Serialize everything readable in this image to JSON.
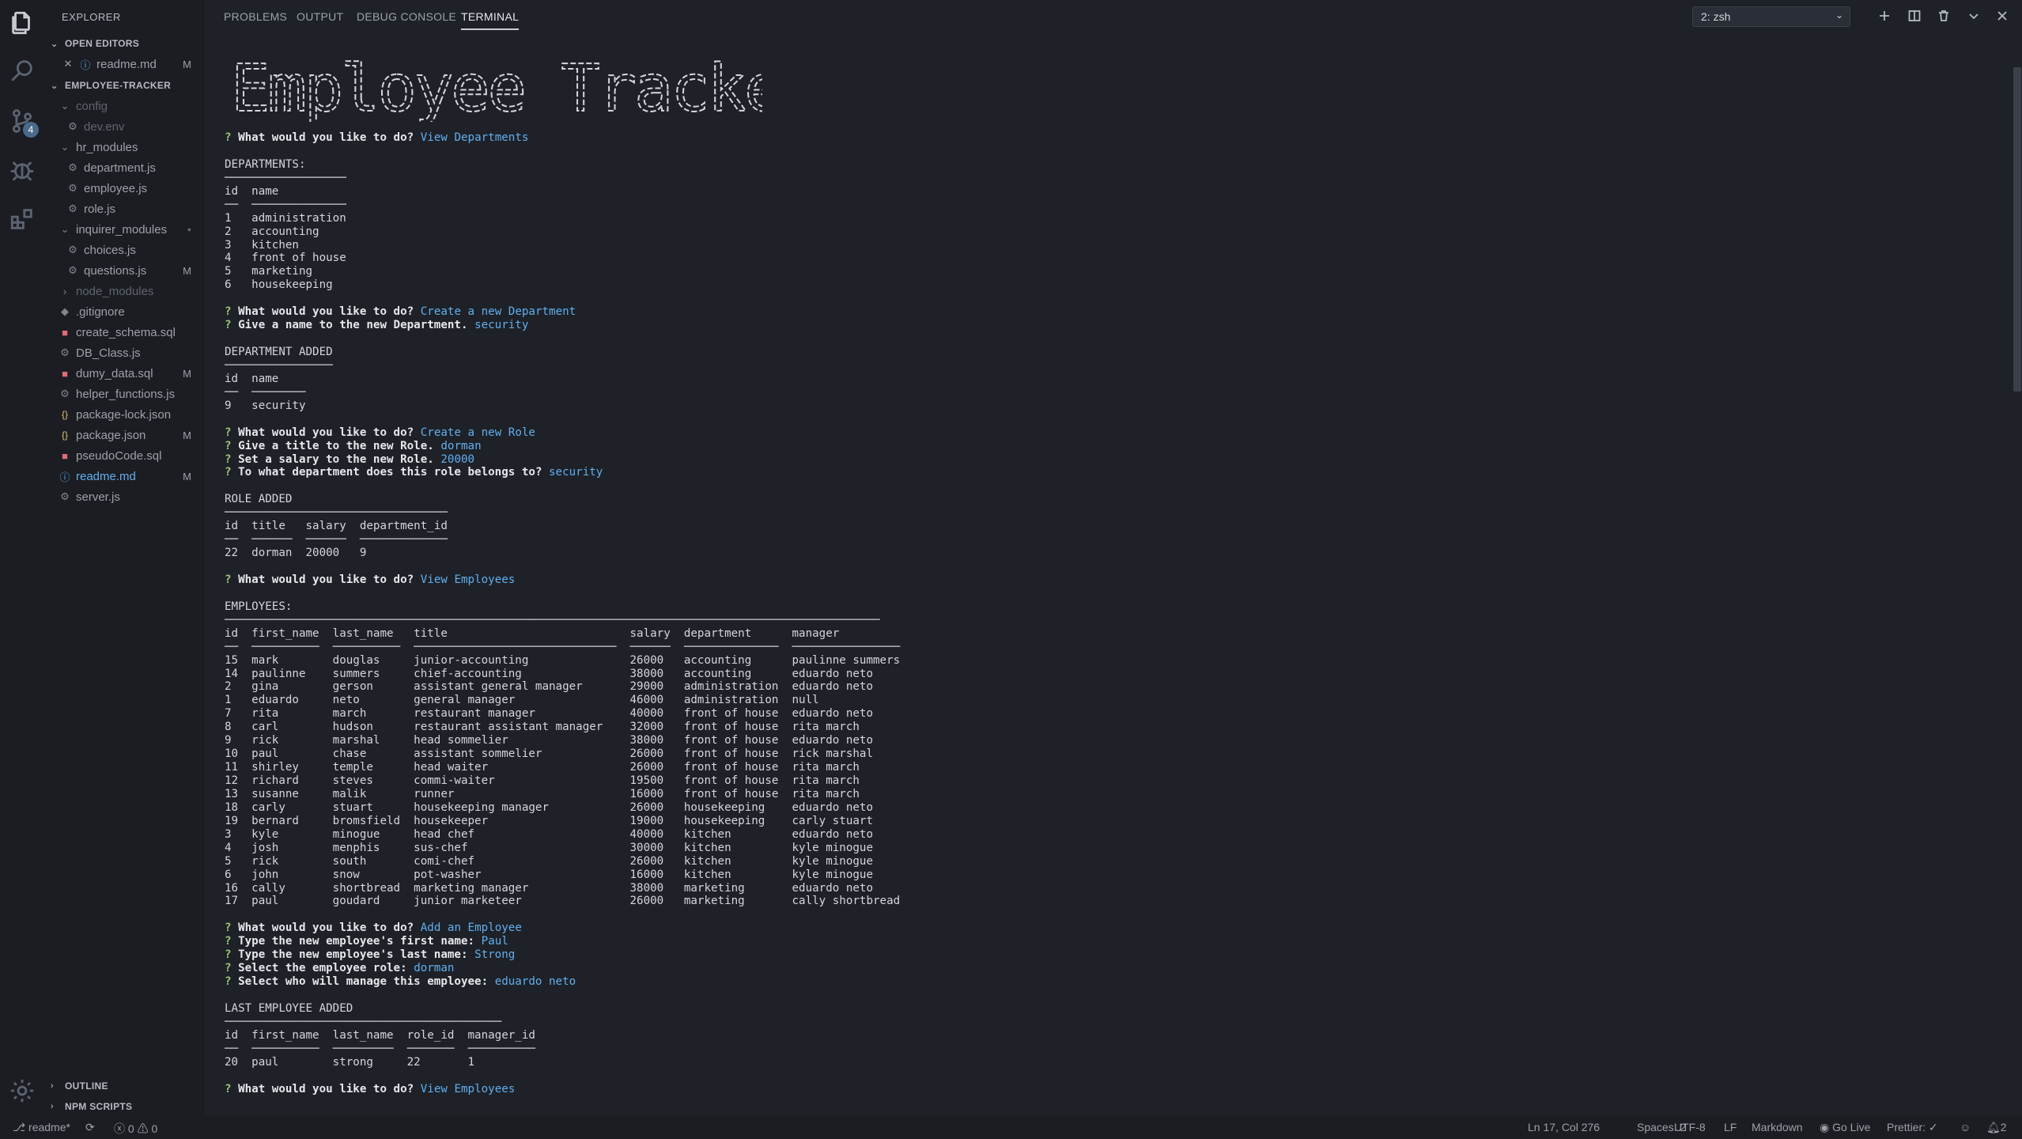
{
  "explorer": {
    "title": "EXPLORER",
    "open_editors_label": "OPEN EDITORS",
    "open_editors": [
      {
        "name": "readme.md",
        "mark": "M"
      }
    ],
    "project_label": "EMPLOYEE-TRACKER",
    "tree": [
      {
        "name": "config",
        "type": "folder",
        "mark": ""
      },
      {
        "name": "dev.env",
        "type": "file",
        "mark": ""
      },
      {
        "name": "hr_modules",
        "type": "folder",
        "mark": ""
      },
      {
        "name": "department.js",
        "type": "file",
        "mark": ""
      },
      {
        "name": "employee.js",
        "type": "file",
        "mark": ""
      },
      {
        "name": "role.js",
        "type": "file",
        "mark": ""
      },
      {
        "name": "inquirer_modules",
        "type": "folder",
        "mark": "●"
      },
      {
        "name": "choices.js",
        "type": "file",
        "mark": ""
      },
      {
        "name": "questions.js",
        "type": "file",
        "mark": "M"
      },
      {
        "name": "node_modules",
        "type": "folder",
        "mark": ""
      },
      {
        "name": ".gitignore",
        "type": "file",
        "mark": ""
      },
      {
        "name": "create_schema.sql",
        "type": "file",
        "mark": ""
      },
      {
        "name": "DB_Class.js",
        "type": "file",
        "mark": ""
      },
      {
        "name": "dumy_data.sql",
        "type": "file",
        "mark": "M"
      },
      {
        "name": "helper_functions.js",
        "type": "file",
        "mark": ""
      },
      {
        "name": "package-lock.json",
        "type": "file",
        "mark": ""
      },
      {
        "name": "package.json",
        "type": "file",
        "mark": "M"
      },
      {
        "name": "pseudoCode.sql",
        "type": "file",
        "mark": ""
      },
      {
        "name": "readme.md",
        "type": "file",
        "mark": "M"
      },
      {
        "name": "server.js",
        "type": "file",
        "mark": ""
      }
    ],
    "outline_label": "OUTLINE",
    "npm_scripts_label": "NPM SCRIPTS"
  },
  "activity": {
    "source_control_badge": "4"
  },
  "panel": {
    "tabs": [
      "PROBLEMS",
      "OUTPUT",
      "DEBUG CONSOLE",
      "TERMINAL"
    ],
    "active_tab": "TERMINAL",
    "terminal_select": "2: zsh"
  },
  "terminal": {
    "banner_text": "Employee Tracker",
    "lines": [
      {
        "kind": "q",
        "q": "What would you like to do?",
        "a": "View Departments"
      },
      {
        "kind": "blank"
      },
      {
        "kind": "text",
        "text": "DEPARTMENTS:"
      },
      {
        "kind": "text",
        "text": "──────────────────"
      },
      {
        "kind": "text",
        "text": "id  name"
      },
      {
        "kind": "text",
        "text": "──  ──────────────"
      },
      {
        "kind": "text",
        "text": "1   administration"
      },
      {
        "kind": "text",
        "text": "2   accounting"
      },
      {
        "kind": "text",
        "text": "3   kitchen"
      },
      {
        "kind": "text",
        "text": "4   front of house"
      },
      {
        "kind": "text",
        "text": "5   marketing"
      },
      {
        "kind": "text",
        "text": "6   housekeeping"
      },
      {
        "kind": "blank"
      },
      {
        "kind": "q",
        "q": "What would you like to do?",
        "a": "Create a new Department"
      },
      {
        "kind": "q",
        "q": "Give a name to the new Department.",
        "a": "security"
      },
      {
        "kind": "blank"
      },
      {
        "kind": "text",
        "text": "DEPARTMENT ADDED"
      },
      {
        "kind": "text",
        "text": "────────────────"
      },
      {
        "kind": "text",
        "text": "id  name"
      },
      {
        "kind": "text",
        "text": "──  ────────"
      },
      {
        "kind": "text",
        "text": "9   security"
      },
      {
        "kind": "blank"
      },
      {
        "kind": "q",
        "q": "What would you like to do?",
        "a": "Create a new Role"
      },
      {
        "kind": "q",
        "q": "Give a title to the new Role.",
        "a": "dorman"
      },
      {
        "kind": "q",
        "q": "Set a salary to the new Role.",
        "a": "20000"
      },
      {
        "kind": "q",
        "q": "To what department does this role belongs to?",
        "a": "security"
      },
      {
        "kind": "blank"
      },
      {
        "kind": "text",
        "text": "ROLE ADDED"
      },
      {
        "kind": "text",
        "text": "─────────────────────────────────"
      },
      {
        "kind": "text",
        "text": "id  title   salary  department_id"
      },
      {
        "kind": "text",
        "text": "──  ──────  ──────  ─────────────"
      },
      {
        "kind": "text",
        "text": "22  dorman  20000   9"
      },
      {
        "kind": "blank"
      },
      {
        "kind": "q",
        "q": "What would you like to do?",
        "a": "View Employees"
      },
      {
        "kind": "blank"
      },
      {
        "kind": "text",
        "text": "EMPLOYEES:"
      },
      {
        "kind": "text",
        "text": "─────────────────────────────────────────────────────────────────────────────────────────────────"
      },
      {
        "kind": "text",
        "text": "id  first_name  last_name   title                           salary  department      manager"
      },
      {
        "kind": "text",
        "text": "──  ──────────  ──────────  ──────────────────────────────  ──────  ──────────────  ────────────────"
      },
      {
        "kind": "text",
        "text": "15  mark        douglas     junior-accounting               26000   accounting      paulinne summers"
      },
      {
        "kind": "text",
        "text": "14  paulinne    summers     chief-accounting                38000   accounting      eduardo neto"
      },
      {
        "kind": "text",
        "text": "2   gina        gerson      assistant general manager       29000   administration  eduardo neto"
      },
      {
        "kind": "text",
        "text": "1   eduardo     neto        general manager                 46000   administration  null"
      },
      {
        "kind": "text",
        "text": "7   rita        march       restaurant manager              40000   front of house  eduardo neto"
      },
      {
        "kind": "text",
        "text": "8   carl        hudson      restaurant assistant manager    32000   front of house  rita march"
      },
      {
        "kind": "text",
        "text": "9   rick        marshal     head sommelier                  38000   front of house  eduardo neto"
      },
      {
        "kind": "text",
        "text": "10  paul        chase       assistant sommelier             26000   front of house  rick marshal"
      },
      {
        "kind": "text",
        "text": "11  shirley     temple      head waiter                     26000   front of house  rita march"
      },
      {
        "kind": "text",
        "text": "12  richard     steves      commi-waiter                    19500   front of house  rita march"
      },
      {
        "kind": "text",
        "text": "13  susanne     malik       runner                          16000   front of house  rita march"
      },
      {
        "kind": "text",
        "text": "18  carly       stuart      housekeeping manager            26000   housekeeping    eduardo neto"
      },
      {
        "kind": "text",
        "text": "19  bernard     bromsfield  housekeeper                     19000   housekeeping    carly stuart"
      },
      {
        "kind": "text",
        "text": "3   kyle        minogue     head chef                       40000   kitchen         eduardo neto"
      },
      {
        "kind": "text",
        "text": "4   josh        menphis     sus-chef                        30000   kitchen         kyle minogue"
      },
      {
        "kind": "text",
        "text": "5   rick        south       comi-chef                       26000   kitchen         kyle minogue"
      },
      {
        "kind": "text",
        "text": "6   john        snow        pot-washer                      16000   kitchen         kyle minogue"
      },
      {
        "kind": "text",
        "text": "16  cally       shortbread  marketing manager               38000   marketing       eduardo neto"
      },
      {
        "kind": "text",
        "text": "17  paul        goudard     junior marketeer                26000   marketing       cally shortbread"
      },
      {
        "kind": "blank"
      },
      {
        "kind": "q",
        "q": "What would you like to do?",
        "a": "Add an Employee"
      },
      {
        "kind": "q",
        "q": "Type the new employee's first name:",
        "a": "Paul"
      },
      {
        "kind": "q",
        "q": "Type the new employee's last name:",
        "a": "Strong"
      },
      {
        "kind": "q",
        "q": "Select the employee role:",
        "a": "dorman"
      },
      {
        "kind": "q",
        "q": "Select who will manage this employee:",
        "a": "eduardo neto"
      },
      {
        "kind": "blank"
      },
      {
        "kind": "text",
        "text": "LAST EMPLOYEE ADDED"
      },
      {
        "kind": "text",
        "text": "─────────────────────────────────────────"
      },
      {
        "kind": "text",
        "text": "id  first_name  last_name  role_id  manager_id"
      },
      {
        "kind": "text",
        "text": "──  ──────────  ─────────  ───────  ──────────"
      },
      {
        "kind": "text",
        "text": "20  paul        strong     22       1"
      },
      {
        "kind": "blank"
      },
      {
        "kind": "q",
        "q": "What would you like to do?",
        "a": "View Employees"
      }
    ]
  },
  "statusbar": {
    "branch": "readme*",
    "errors": "0",
    "warnings": "0",
    "position": "Ln 17, Col 276",
    "spaces": "Spaces: 2",
    "encoding": "UTF-8",
    "eol": "LF",
    "language": "Markdown",
    "golive": "Go Live",
    "prettier": "Prettier: ✓",
    "notifications": "2"
  },
  "colors": {
    "background": "#1e2127",
    "sidebar": "#1b1d23",
    "answer": "#61afef",
    "question_mark": "#98c379"
  }
}
